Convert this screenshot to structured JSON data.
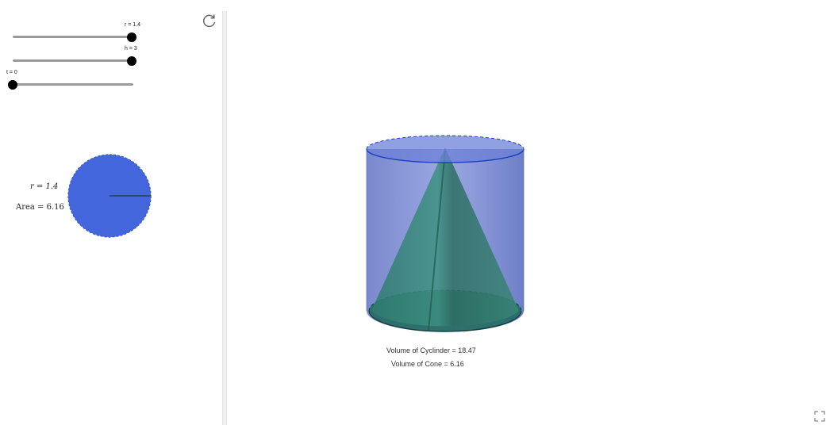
{
  "sliders": [
    {
      "label": "r = 1.4",
      "value": 1.4
    },
    {
      "label": "h = 3",
      "value": 3
    },
    {
      "label": "t = 0",
      "value": 0
    }
  ],
  "circle_view": {
    "r_label": "r = 1.4",
    "area_label": "Area = 6.16",
    "fill_color": "#4466dd"
  },
  "solid_view": {
    "cylinder_color": "#5a70c8",
    "cone_color": "#2e7a6a",
    "edge_color": "#1a3fc0",
    "volume_cylinder": "Volume of Cyclinder = 18.47",
    "volume_cone": "Volume of Cone = 6.16"
  },
  "icons": {
    "reset": "reset-icon",
    "fullscreen": "fullscreen-icon"
  }
}
